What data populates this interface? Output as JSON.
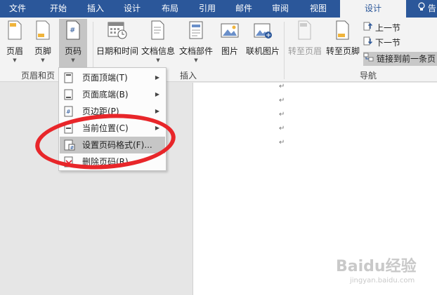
{
  "tabs": [
    "文件",
    "开始",
    "插入",
    "设计",
    "布局",
    "引用",
    "邮件",
    "审阅",
    "视图",
    "设计"
  ],
  "tell_me": "告",
  "ribbon": {
    "header": "页眉",
    "footer": "页脚",
    "page_number": "页码",
    "date_time": "日期和时间",
    "doc_info": "文档信息",
    "doc_parts": "文档部件",
    "picture": "图片",
    "online_picture": "联机图片",
    "goto_header": "转至页眉",
    "goto_footer": "转至页脚",
    "prev_section": "上一节",
    "next_section": "下一节",
    "link_previous": "链接到前一条页",
    "group_header_footer": "页眉和页",
    "group_insert": "插入",
    "group_nav": "导航"
  },
  "menu": [
    {
      "label": "页面顶端(T)",
      "submenu": true
    },
    {
      "label": "页面底端(B)",
      "submenu": true
    },
    {
      "label": "页边距(P)",
      "submenu": true
    },
    {
      "label": "当前位置(C)",
      "submenu": true
    },
    {
      "label": "设置页码格式(F)...",
      "submenu": false
    },
    {
      "label": "删除页码(R)",
      "submenu": false
    }
  ],
  "document": {
    "para_marks": [
      "↵",
      "↵",
      "↵",
      "↵",
      "↵"
    ]
  },
  "watermark": {
    "brand": "Baidu经验",
    "url": "jingyan.baidu.com"
  },
  "colors": {
    "tabbar": "#2b579a",
    "ribbon": "#f3f3f3",
    "annotation": "#e8262a"
  }
}
